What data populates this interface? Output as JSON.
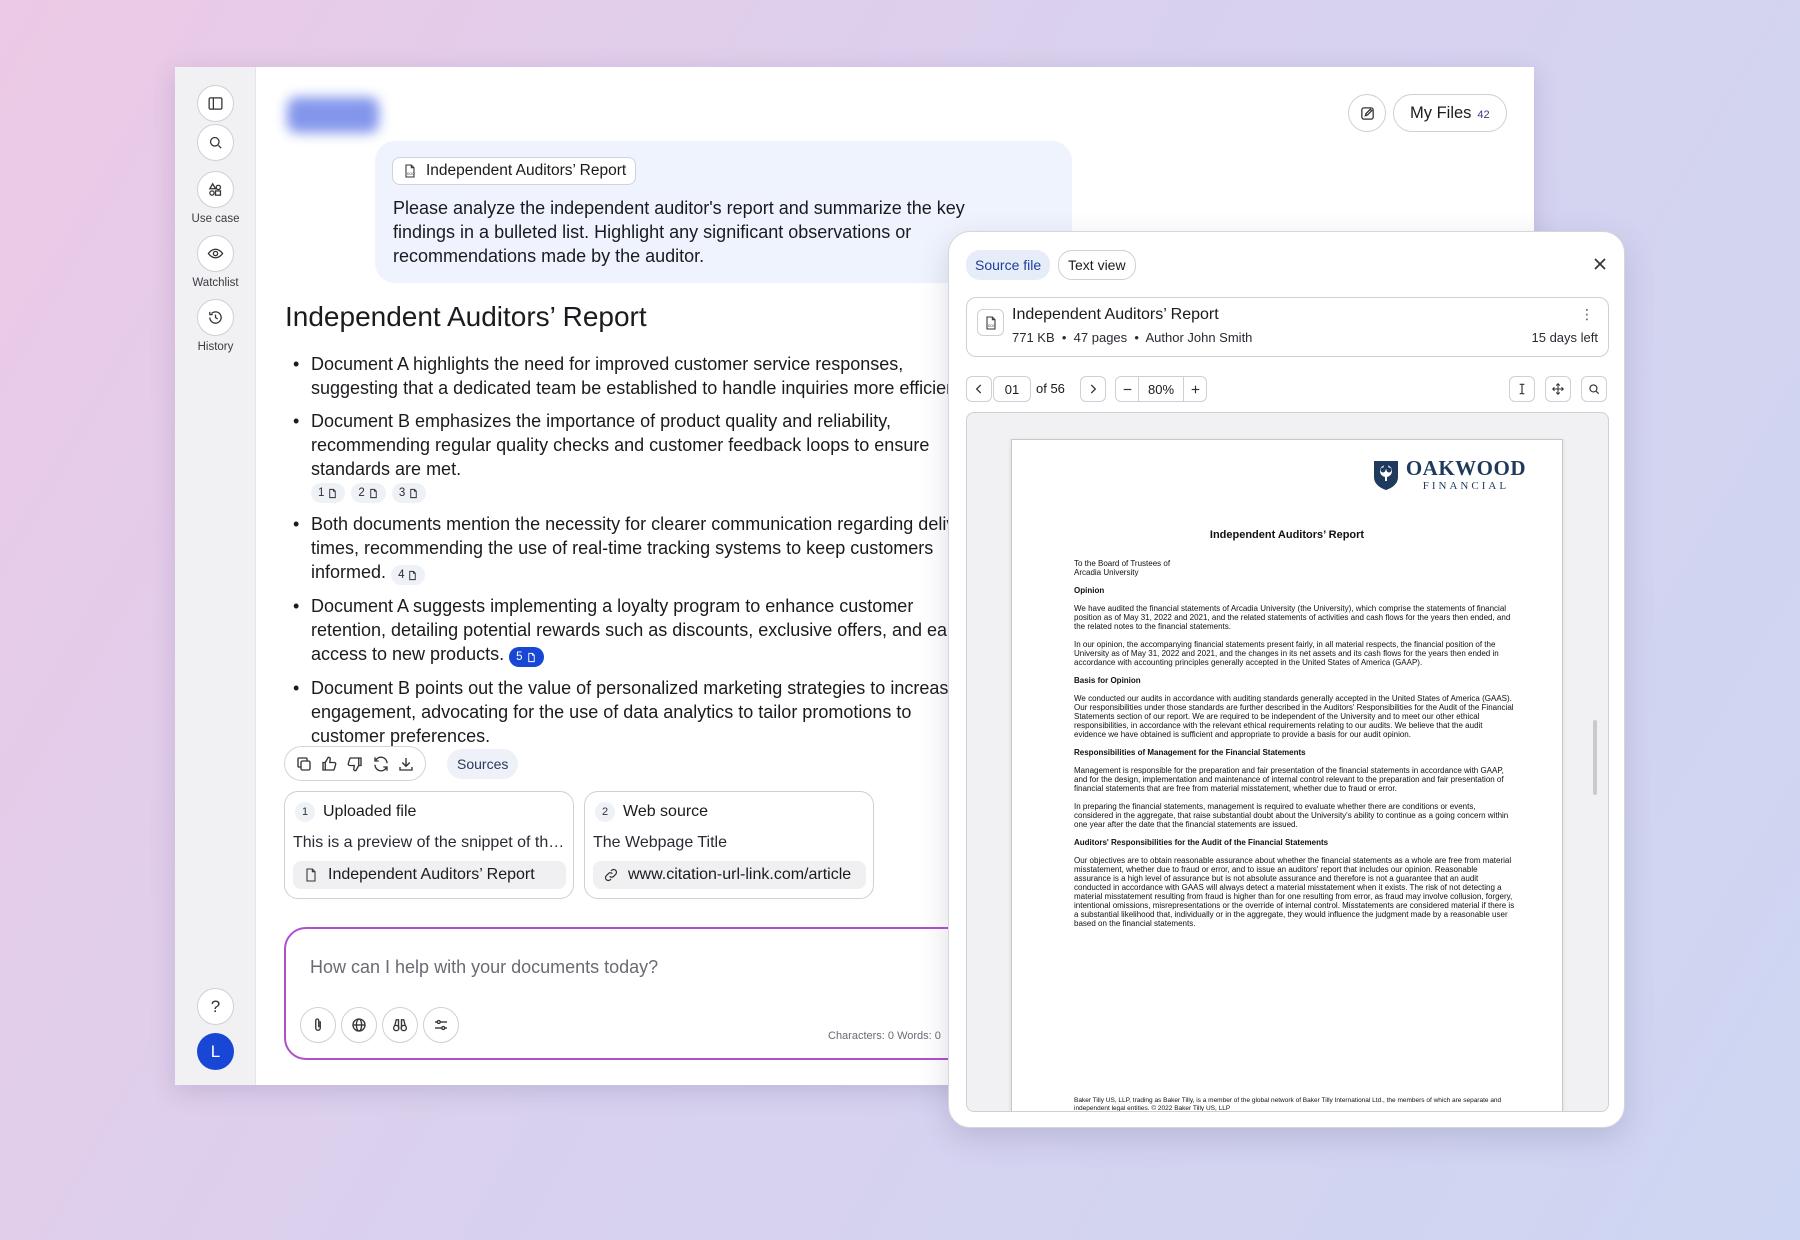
{
  "sidebar": {
    "items": [
      {
        "icon": "panel-toggle-icon",
        "label": ""
      },
      {
        "icon": "search-icon",
        "label": ""
      },
      {
        "icon": "use-case-icon",
        "label": "Use case"
      },
      {
        "icon": "eye-icon",
        "label": "Watchlist"
      },
      {
        "icon": "history-icon",
        "label": "History"
      }
    ],
    "help_label": "?",
    "avatar_initial": "L"
  },
  "header": {
    "my_files_label": "My Files",
    "my_files_count": "42"
  },
  "user_message": {
    "attachment": "Independent Auditors’ Report",
    "text": "Please analyze the independent auditor's report and summarize the key findings in a bulleted list. Highlight any significant observations or recommendations made by the auditor."
  },
  "response": {
    "title": "Independent Auditors’ Report",
    "bullets": [
      {
        "text": " Document A highlights the need for improved customer service responses, suggesting that a dedicated team be established to handle inquiries more efficiently."
      },
      {
        "text": "Document B emphasizes the importance of product quality and reliability, recommending regular quality checks and customer feedback loops to ensure standards are met."
      },
      {
        "text": "Both documents mention the necessity for clearer communication regarding delivery times, recommending the use of real-time tracking systems to keep customers informed."
      },
      {
        "text": "Document A suggests implementing a loyalty program to enhance customer retention, detailing potential rewards such as discounts, exclusive offers, and early access to new products."
      },
      {
        "text": "Document B points out the value of personalized marketing strategies to increase engagement, advocating for the use of data analytics to tailor promotions to customer preferences."
      }
    ],
    "citations": {
      "b2": [
        "1",
        "2",
        "3"
      ],
      "b3": [
        "4"
      ],
      "b4": [
        "5"
      ]
    },
    "sources_label": "Sources"
  },
  "sources": [
    {
      "num": "1",
      "type": "Uploaded file",
      "preview": "This is a preview of the snippet of the uploaded file",
      "link": "Independent Auditors’ Report"
    },
    {
      "num": "2",
      "type": "Web source",
      "preview": "The Webpage Title",
      "link": "www.citation-url-link.com/article"
    }
  ],
  "composer": {
    "placeholder": "How can I help with your documents today?",
    "counter": "Characters: 0  Words: 0"
  },
  "viewer": {
    "tabs": [
      "Source file",
      "Text view"
    ],
    "file": {
      "name": "Independent Auditors’ Report",
      "size": "771 KB",
      "pages": "47 pages",
      "author": "Author John Smith",
      "expiry": "15 days left"
    },
    "page_current": "01",
    "page_total": "of 56",
    "zoom": "80%",
    "document": {
      "brand": "OAKWOOD",
      "brand_sub": "FINANCIAL",
      "title": "Independent Auditors’ Report",
      "address": "To the Board of Trustees of\nArcadia University",
      "h_opinion": "Opinion",
      "p1": "We have audited the financial statements of Arcadia University (the University), which comprise the statements of financial position as of May 31, 2022 and 2021, and the related statements of activities and cash flows for the years then ended, and the related notes to the financial statements.",
      "p2": "In our opinion, the accompanying financial statements present fairly, in all material respects, the financial position of the University as of May 31, 2022 and 2021, and the changes in its net assets and its cash flows for the years then ended in accordance with accounting principles generally accepted in the United States of America (GAAP).",
      "h_basis": "Basis for Opinion",
      "p3": "We conducted our audits in accordance with auditing standards generally accepted in the United States of America (GAAS). Our responsibilities under those standards are further described in the Auditors' Responsibilities for the Audit of the Financial Statements section of our report. We are required to be independent of the University and to meet our other ethical responsibilities, in accordance with the relevant ethical requirements relating to our audits. We believe that the audit evidence we have obtained is sufficient and appropriate to provide a basis for our audit opinion.",
      "h_mgmt": "Responsibilities of Management for the Financial Statements",
      "p4": "Management is responsible for the preparation and fair presentation of the financial statements in accordance with GAAP, and for the design, implementation and maintenance of internal control relevant to the preparation and fair presentation of financial statements that are free from material misstatement, whether due to fraud or error.",
      "p5": "In preparing the financial statements, management is required to evaluate whether there are conditions or events, considered in the aggregate, that raise substantial doubt about the University's ability to continue as a going concern within one year after the date that the financial statements are issued.",
      "h_aud": "Auditors' Responsibilities for the Audit of the Financial Statements",
      "p6": "Our objectives are to obtain reasonable assurance about whether the financial statements as a whole are free from material misstatement, whether due to fraud or error, and to issue an auditors' report that includes our opinion. Reasonable assurance is a high level of assurance but is not absolute assurance and therefore is not a guarantee that an audit conducted in accordance with GAAS will always detect a material misstatement when it exists. The risk of not detecting a material misstatement resulting from fraud is higher than for one resulting from error, as fraud may involve collusion, forgery, intentional omissions, misrepresentations or the override of internal control. Misstatements are considered material if there is a substantial likelihood that, individually or in the aggregate, they would influence the judgment made by a reasonable user based on the financial statements.",
      "footer": "Baker Tilly US, LLP, trading as Baker Tilly, is a member of the global network of Baker Tilly International Ltd., the members of which are separate and independent legal entities. © 2022 Baker Tilly US, LLP"
    }
  },
  "colors": {
    "accent": "#1847d6",
    "composer_border": "#b04ed0",
    "bubble_bg": "#eef3fd"
  }
}
